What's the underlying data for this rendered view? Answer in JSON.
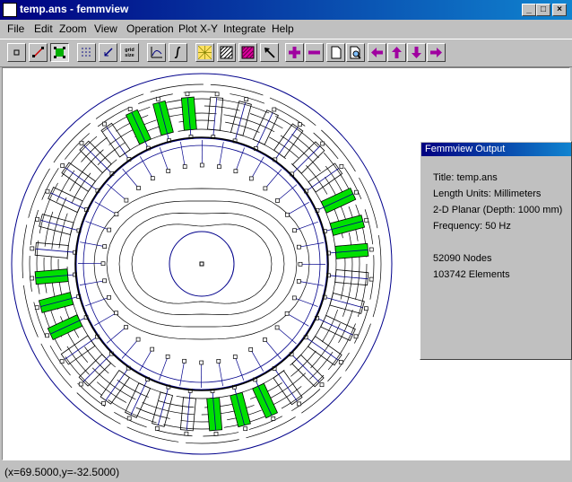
{
  "window": {
    "title": "temp.ans - femmview",
    "min": "_",
    "max": "□",
    "close": "×"
  },
  "menu": [
    {
      "label": "File"
    },
    {
      "label": "Edit"
    },
    {
      "label": "Zoom"
    },
    {
      "label": "View"
    },
    {
      "label": "Operation"
    },
    {
      "label": "Plot X-Y"
    },
    {
      "label": "Integrate"
    },
    {
      "label": "Help"
    }
  ],
  "toolbar": {
    "buttons": [
      "point-mode-icon",
      "segment-mode-icon",
      "block-mode-icon",
      "grid-icon",
      "snap-grid-icon",
      "grid-size-icon",
      "plot-xy-icon",
      "integrate-icon",
      "show-mesh-icon",
      "hatch-icon",
      "density-plot-icon",
      "pointer-icon",
      "zoom-in-icon",
      "zoom-out-icon",
      "page-icon",
      "zoom-window-icon",
      "pan-left-icon",
      "pan-up-icon",
      "pan-down-icon",
      "pan-right-icon"
    ],
    "grid_size_label": "grid size"
  },
  "status": {
    "coords": "(x=69.5000,y=-32.5000)"
  },
  "output": {
    "title": "Femmview Output",
    "lines": [
      "Title: temp.ans",
      "Length Units: Millimeters",
      "2-D Planar (Depth: 1000 mm)",
      "Frequency: 50 Hz",
      "",
      "52090 Nodes",
      "103742 Elements"
    ]
  },
  "colors": {
    "title_bar": "#000080",
    "field_lines": "#000000",
    "geometry": "#00008b",
    "slot_fill": "#00e000"
  }
}
